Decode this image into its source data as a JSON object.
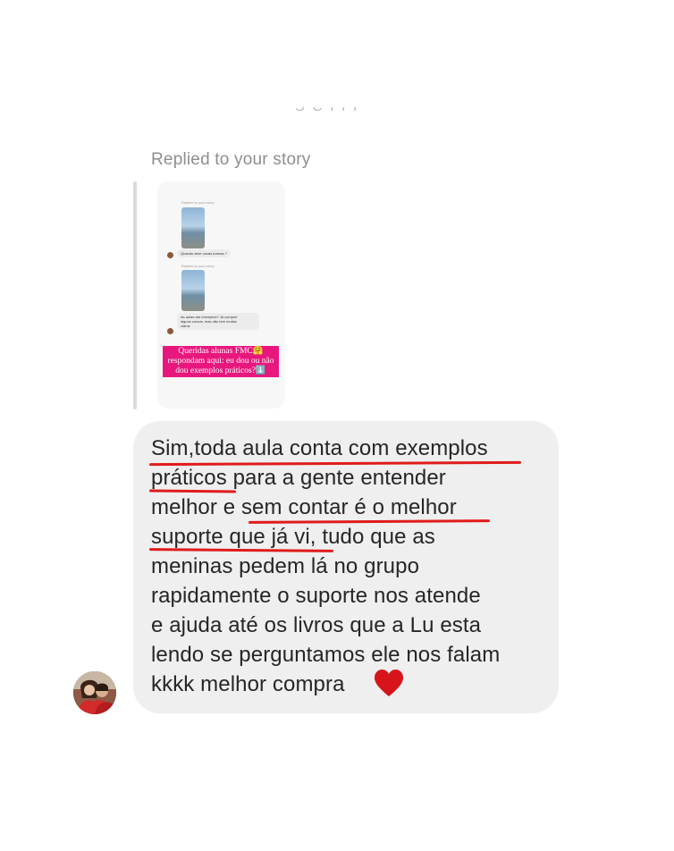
{
  "header": {
    "replied_label": "Replied to your story",
    "cut_text": "S C I I I"
  },
  "story_preview": {
    "top_label": "Replied to your story",
    "question_1": "Quando abre novas turmas ?",
    "second_label": "Replied to your story",
    "question_2_lines": [
      "As aulas dar exemplos? Já comprei",
      "alguns cursos, mas não tem muitos",
      "claros"
    ],
    "overlay_lines": [
      "Queridas alunas FMC🤗",
      "respondam aqui: eu dou ou não",
      "dou exemplos práticos?⬇️"
    ]
  },
  "message": {
    "lines": [
      "Sim,toda aula conta com exemplos",
      "práticos para a gente entender",
      "melhor e sem contar é o melhor",
      "suporte que já vi, tudo que as",
      "meninas pedem lá no grupo",
      "rapidamente o suporte nos atende",
      "e ajuda até os livros que a Lu esta",
      "lendo se perguntamos ele nos falam",
      "kkkk melhor compra"
    ],
    "emoji": "heart-icon",
    "underline_color": "#e01b1b",
    "bubble_color": "#efefef"
  },
  "sender": {
    "avatar": "avatar"
  }
}
